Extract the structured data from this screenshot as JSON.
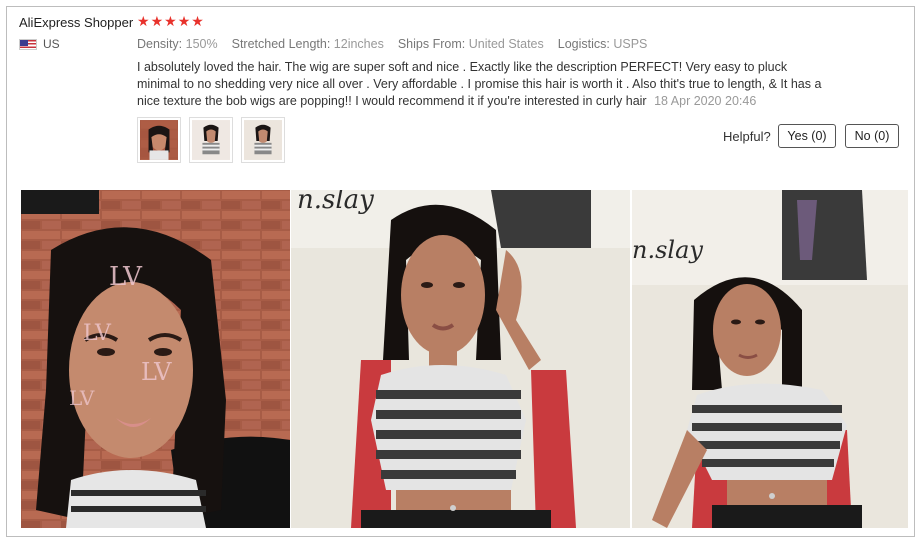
{
  "review": {
    "username": "AliExpress Shopper",
    "rating": 5,
    "country": "US",
    "attributes": [
      {
        "key": "Density:",
        "value": "150%"
      },
      {
        "key": "Stretched Length:",
        "value": "12inches"
      },
      {
        "key": "Ships From:",
        "value": "United States"
      },
      {
        "key": "Logistics:",
        "value": "USPS"
      }
    ],
    "text": "I absolutely loved the hair. The wig are super soft and nice . Exactly like the description PERFECT! Very easy to pluck minimal to no shedding very nice all over . Very affordable . I promise this hair is worth it . Also thit's true to length, & It has a nice texture the bob wigs are popping!! I would recommend it if you're interested in curly hair",
    "date": "18 Apr 2020 20:46"
  },
  "helpful": {
    "label": "Helpful?",
    "yes_label": "Yes (0)",
    "no_label": "No (0)"
  },
  "colors": {
    "star": "#e8322c",
    "border": "#bdbdbd"
  },
  "photos": {
    "photo2_sign": "n.slay",
    "photo3_sign": "n.slay"
  }
}
